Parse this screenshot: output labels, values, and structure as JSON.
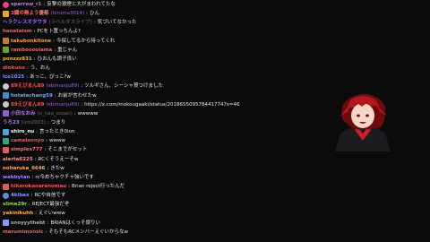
{
  "chat": {
    "messages": [
      {
        "icon": "heart-icon",
        "icon_color": "#e0457b",
        "name": "sparrow_r1",
        "sub": "",
        "text": "反撃の狼煙と大がまわれてたな",
        "name_color": "#b57cff",
        "sub_color": "#888888"
      },
      {
        "icon": "badge-icon",
        "icon_color": "#e5a91f",
        "name": "3鐡の無よう優都",
        "sub": "(hiruma3614)",
        "text": "ひん",
        "name_color": "#ff6c6c",
        "sub_color": "#9c5de0"
      },
      {
        "icon": "",
        "icon_color": "",
        "name": "ヘラクレスオタウタ",
        "sub": "(ラベルダスライブ)",
        "text": "気づいてなかった",
        "name_color": "#a46cff",
        "sub_color": "#6f6f6f"
      },
      {
        "icon": "",
        "icon_color": "",
        "name": "hanataism",
        "sub": "",
        "text": "PCを卜置っちんよ?",
        "name_color": "#ff5a5a",
        "sub_color": "#888888"
      },
      {
        "icon": "badge-icon",
        "icon_color": "#c97b26",
        "name": "takubonkitone",
        "sub": "",
        "text": "今探してるから待ってくれ",
        "name_color": "#e9a25a",
        "sub_color": "#888888"
      },
      {
        "icon": "badge-icon",
        "icon_color": "#6ea135",
        "name": "ramboooolama",
        "sub": "",
        "text": "重じゃん",
        "name_color": "#e36a6a",
        "sub_color": "#888888"
      },
      {
        "icon": "",
        "icon_color": "",
        "name": "ponzzz831",
        "sub": "",
        "text": "ひおんも調子良い",
        "name_color": "#e6ba3d",
        "sub_color": "#888888"
      },
      {
        "icon": "",
        "icon_color": "",
        "name": "dinkuno",
        "sub": "",
        "text": "う、おん",
        "name_color": "#e06060",
        "sub_color": "#888888"
      },
      {
        "icon": "",
        "icon_color": "",
        "name": "lco1025",
        "sub": "",
        "text": "あっこ、ぴっこ?w",
        "name_color": "#7a8cff",
        "sub_color": "#888888"
      },
      {
        "icon": "skull-icon",
        "icon_color": "#c9c9c9",
        "name": "89えびまん89",
        "sub": "(ebimanju89)",
        "text": "ツルギさん、シーシャ買つけました",
        "name_color": "#ff4d4d",
        "sub_color": "#9c5de0"
      },
      {
        "icon": "badge-icon",
        "icon_color": "#3f8ecf",
        "name": "hotatechang59",
        "sub": "",
        "text": "お前が言わせたw",
        "name_color": "#6aa9ff",
        "sub_color": "#888888"
      },
      {
        "icon": "skull-icon",
        "icon_color": "#c9c9c9",
        "name": "89えびまん89",
        "sub": "(ebimanju89)",
        "text": "https://x.com/mokougaaki/status/2018655095784417747s=46",
        "name_color": "#ff4d4d",
        "sub_color": "#9c5de0"
      },
      {
        "icon": "badge-icon",
        "icon_color": "#9b59d6",
        "name": "小田なおみ",
        "sub": "(o_nao_ossan)",
        "text": "wwwww",
        "name_color": "#c070ff",
        "sub_color": "#6f6f6f"
      },
      {
        "icon": "",
        "icon_color": "",
        "name": "うろ23",
        "sub": "(uro2003)",
        "text": "つまり",
        "name_color": "#b07cff",
        "sub_color": "#6f6f6f"
      },
      {
        "icon": "badge-icon",
        "icon_color": "#4f9fdb",
        "name": "shiro_nu",
        "sub": "",
        "text": "言ったとき0ion",
        "name_color": "#ffffff",
        "sub_color": "#888888"
      },
      {
        "icon": "badge-icon",
        "icon_color": "#3a9f8a",
        "name": "cameleonyo",
        "sub": "",
        "text": "wwww",
        "name_color": "#ff4d6e",
        "sub_color": "#888888"
      },
      {
        "icon": "badge-icon",
        "icon_color": "#e25a5a",
        "name": "simplex777",
        "sub": "",
        "text": "そこまでがセット",
        "name_color": "#ff6a6a",
        "sub_color": "#888888"
      },
      {
        "icon": "",
        "icon_color": "",
        "name": "alerta6225",
        "sub": "",
        "text": "RCくそうえーそw",
        "name_color": "#ff8c8c",
        "sub_color": "#888888"
      },
      {
        "icon": "",
        "icon_color": "",
        "name": "noharuka_6646",
        "sub": "",
        "text": "きたw",
        "name_color": "#ffb347",
        "sub_color": "#888888"
      },
      {
        "icon": "",
        "icon_color": "",
        "name": "webbytan",
        "sub": "",
        "text": "rc今めちゃクチャ強いです",
        "name_color": "#b07cff",
        "sub_color": "#888888"
      },
      {
        "icon": "badge-icon",
        "icon_color": "#e25a5a",
        "name": "hikarokanaranomau",
        "sub": "",
        "text": "Brian reject行ったんだ",
        "name_color": "#ff5050",
        "sub_color": "#888888"
      },
      {
        "icon": "heart-icon",
        "icon_color": "#5a8ed6",
        "name": "4kibax",
        "sub": "",
        "text": "RCや自信です",
        "name_color": "#7a9cff",
        "sub_color": "#888888"
      },
      {
        "icon": "",
        "icon_color": "",
        "name": "slime29r",
        "sub": "",
        "text": "REJECT最強だぞ",
        "name_color": "#8be04a",
        "sub_color": "#888888"
      },
      {
        "icon": "",
        "icon_color": "",
        "name": "yakinikuhh",
        "sub": "",
        "text": "えぐいwww",
        "name_color": "#ffb347",
        "sub_color": "#888888"
      },
      {
        "icon": "crown-icon",
        "icon_color": "#8899ff",
        "name": "snoyyythebt",
        "sub": "",
        "text": "BRIANはくっそ誤りい",
        "name_color": "#b0b0b0",
        "sub_color": "#888888"
      },
      {
        "icon": "",
        "icon_color": "",
        "name": "marumimonsic",
        "sub": "",
        "text": "そもそもRCメンバーえぐいからなw",
        "name_color": "#ff5a5a",
        "sub_color": "#888888"
      }
    ]
  },
  "avatar": {
    "label": "vtuber-avatar",
    "colors": {
      "hair": "#b3171c",
      "hair_dark": "#6d0a0e",
      "skin": "#f4d7c6",
      "clothes": "#1a1a1f",
      "accent": "#c9202a"
    }
  }
}
